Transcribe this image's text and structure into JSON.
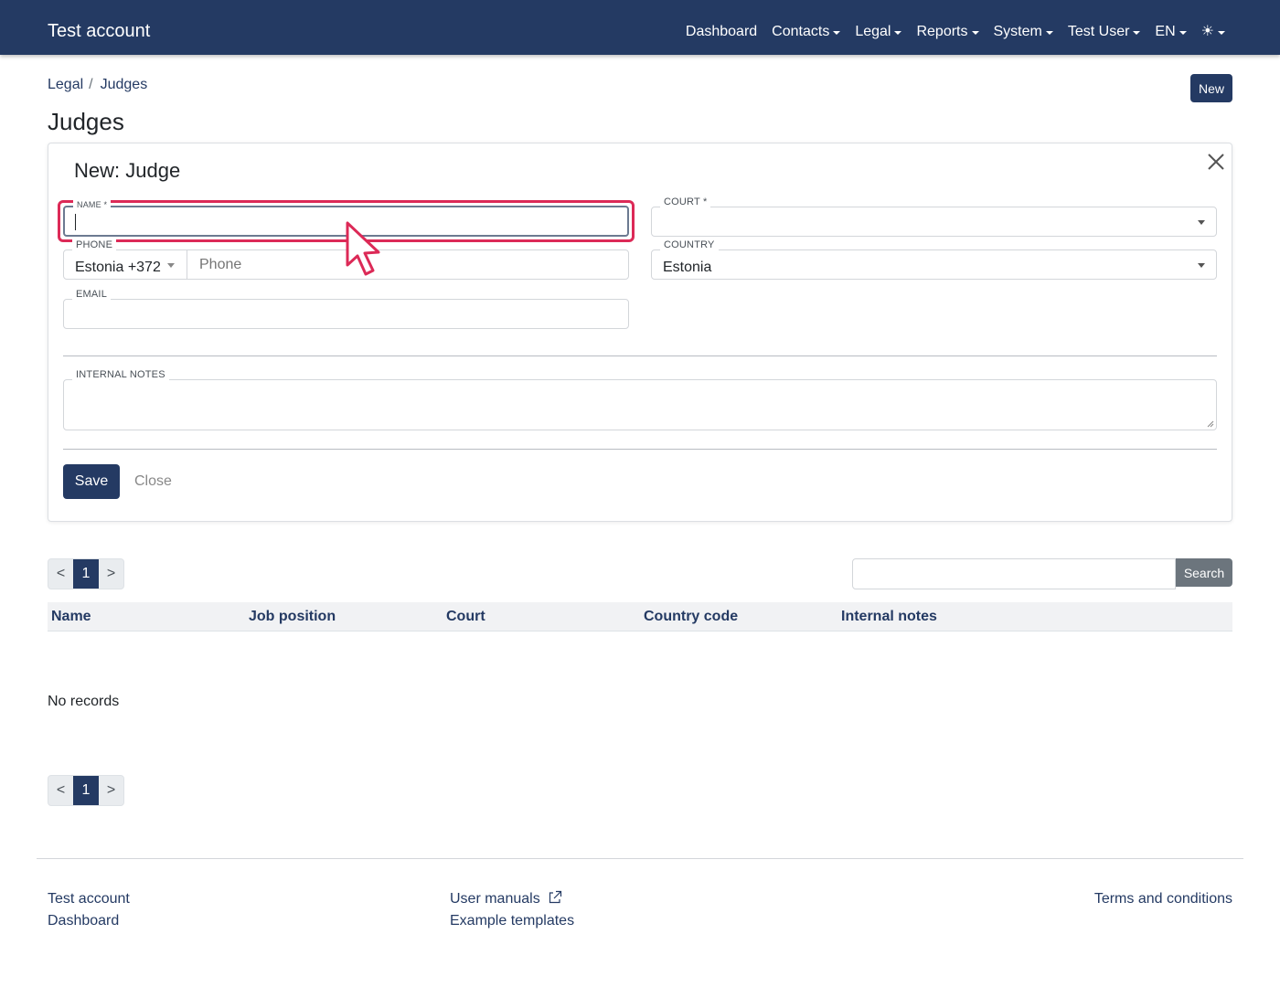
{
  "navbar": {
    "brand": "Test account",
    "items": [
      {
        "label": "Dashboard",
        "dropdown": false
      },
      {
        "label": "Contacts",
        "dropdown": true
      },
      {
        "label": "Legal",
        "dropdown": true
      },
      {
        "label": "Reports",
        "dropdown": true
      },
      {
        "label": "System",
        "dropdown": true
      },
      {
        "label": "Test User",
        "dropdown": true
      },
      {
        "label": "EN",
        "dropdown": true
      }
    ],
    "theme_icon": "☀",
    "theme_icon_name": "sun-icon",
    "bg_color": "#243a63"
  },
  "breadcrumb": {
    "items": [
      "Legal",
      "Judges"
    ],
    "separator": "/"
  },
  "header": {
    "title": "Judges",
    "new_button": "New"
  },
  "form": {
    "title": "New: Judge",
    "close_icon": "close-icon",
    "name": {
      "label": "NAME *",
      "value": ""
    },
    "court": {
      "label": "COURT *",
      "value": ""
    },
    "phone": {
      "label": "PHONE",
      "country_value": "Estonia +372",
      "placeholder": "Phone"
    },
    "country": {
      "label": "COUNTRY",
      "value": "Estonia"
    },
    "email": {
      "label": "EMAIL",
      "value": ""
    },
    "notes": {
      "label": "INTERNAL NOTES",
      "value": ""
    },
    "save_button": "Save",
    "close_button": "Close"
  },
  "pagination": {
    "prev": "<",
    "current": "1",
    "next": ">"
  },
  "search": {
    "value": "",
    "button": "Search"
  },
  "table": {
    "columns": [
      "Name",
      "Job position",
      "Court",
      "Country code",
      "Internal notes"
    ],
    "empty_text": "No records"
  },
  "footer": {
    "col1": [
      "Test account",
      "Dashboard"
    ],
    "col2": [
      "User manuals",
      "Example templates"
    ],
    "col3": [
      "Terms and conditions"
    ],
    "external_icon": "external-link-icon"
  },
  "colors": {
    "primary": "#243a63",
    "highlight": "#dc2a57",
    "secondary": "#6c757d"
  }
}
